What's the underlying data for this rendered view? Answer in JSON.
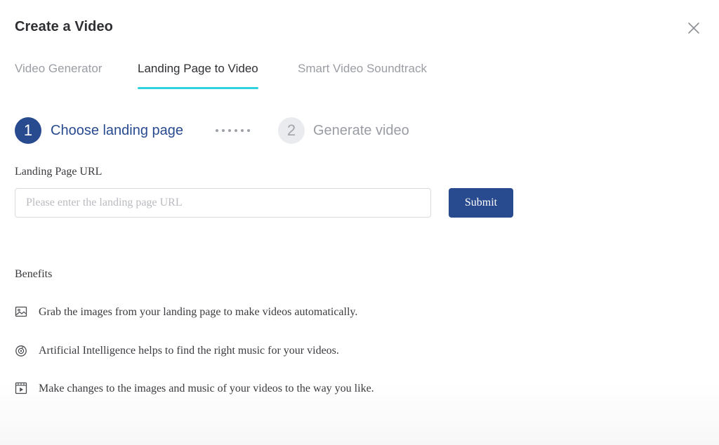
{
  "dialog": {
    "title": "Create a Video",
    "close_icon": "close-icon"
  },
  "tabs": [
    {
      "label": "Video Generator",
      "active": false
    },
    {
      "label": "Landing Page to Video",
      "active": true
    },
    {
      "label": "Smart Video Soundtrack",
      "active": false
    }
  ],
  "steps": [
    {
      "number": "1",
      "label": "Choose landing page",
      "active": true
    },
    {
      "number": "2",
      "label": "Generate video",
      "active": false
    }
  ],
  "form": {
    "label": "Landing Page URL",
    "placeholder": "Please enter the landing page URL",
    "value": "",
    "submit_label": "Submit"
  },
  "benefits": {
    "title": "Benefits",
    "items": [
      {
        "icon": "image-icon",
        "text": "Grab the images from your landing page to make videos automatically."
      },
      {
        "icon": "music-disc-icon",
        "text": "Artificial Intelligence helps to find the right music for your videos."
      },
      {
        "icon": "video-frame-icon",
        "text": "Make changes to the images and music of your videos to the way you like."
      }
    ]
  },
  "colors": {
    "primary": "#284a8f",
    "tab_underline": "#2fd3e0",
    "inactive_text": "#9a9da3"
  }
}
